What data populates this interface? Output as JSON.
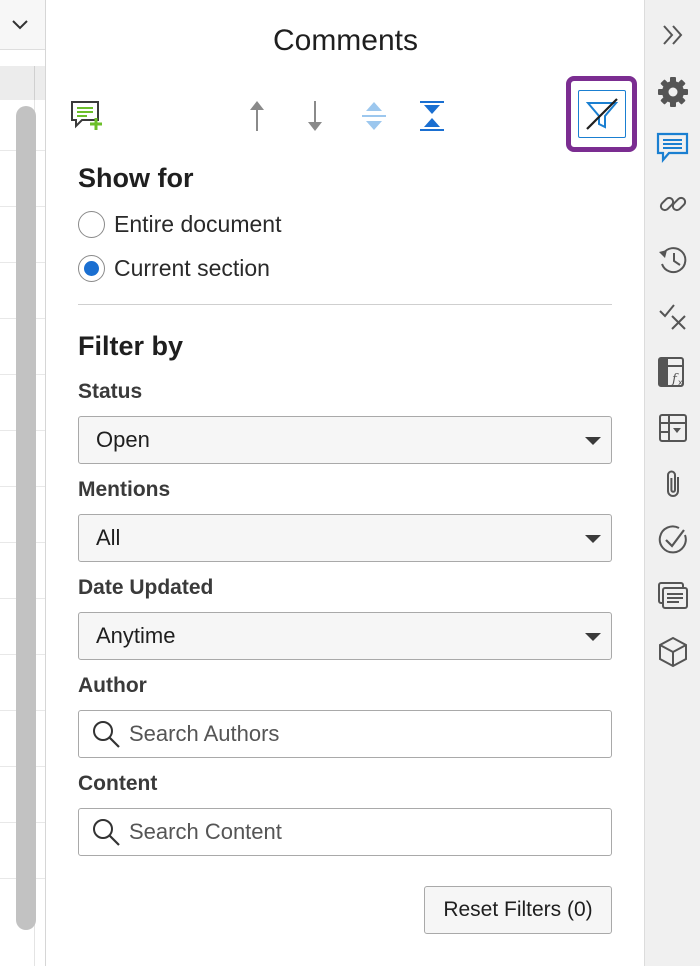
{
  "panel": {
    "title": "Comments"
  },
  "show_for": {
    "heading": "Show for",
    "options": [
      {
        "label": "Entire document",
        "checked": false
      },
      {
        "label": "Current section",
        "checked": true
      }
    ]
  },
  "filter_by": {
    "heading": "Filter by",
    "status": {
      "label": "Status",
      "value": "Open"
    },
    "mentions": {
      "label": "Mentions",
      "value": "All"
    },
    "date_updated": {
      "label": "Date Updated",
      "value": "Anytime"
    },
    "author": {
      "label": "Author",
      "placeholder": "Search Authors"
    },
    "content": {
      "label": "Content",
      "placeholder": "Search Content"
    }
  },
  "reset_button": {
    "label": "Reset Filters (0)"
  },
  "colors": {
    "accent": "#1a7fd1",
    "filter_highlight": "#7b2d91",
    "add_comment_green": "#6cbf2a"
  },
  "toolbar_icons": [
    "add-comment-icon",
    "arrow-up-icon",
    "arrow-down-icon",
    "expand-all-icon",
    "collapse-all-icon",
    "filter-off-icon"
  ],
  "rail_icons": [
    "collapse-panel-icon",
    "gear-icon",
    "comments-icon",
    "link-icon",
    "history-icon",
    "review-icon",
    "formula-icon",
    "table-dropdown-icon",
    "paperclip-icon",
    "check-circle-icon",
    "list-icon",
    "cube-icon"
  ]
}
